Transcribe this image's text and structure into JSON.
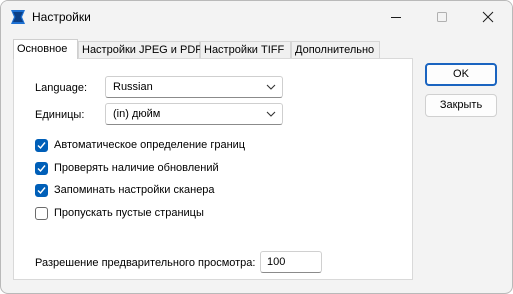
{
  "window": {
    "title": "Настройки"
  },
  "tabs": [
    {
      "label": "Основное"
    },
    {
      "label": "Настройки JPEG и PDF"
    },
    {
      "label": "Настройки TIFF"
    },
    {
      "label": "Дополнительно"
    }
  ],
  "general": {
    "language_label": "Language:",
    "language_value": "Russian",
    "units_label": "Единицы:",
    "units_value": "(in) дюйм",
    "checkboxes": [
      {
        "label": "Автоматическое определение границ",
        "checked": true
      },
      {
        "label": "Проверять наличие обновлений",
        "checked": true
      },
      {
        "label": "Запоминать настройки сканера",
        "checked": true
      },
      {
        "label": "Пропускать пустые страницы",
        "checked": false
      }
    ],
    "preview_resolution_label": "Разрешение предварительного просмотра:",
    "preview_resolution_value": "100"
  },
  "buttons": {
    "ok": "OK",
    "close": "Закрыть"
  },
  "colors": {
    "accent": "#005fb8",
    "panel": "#ffffff",
    "window": "#f3f3f3"
  }
}
